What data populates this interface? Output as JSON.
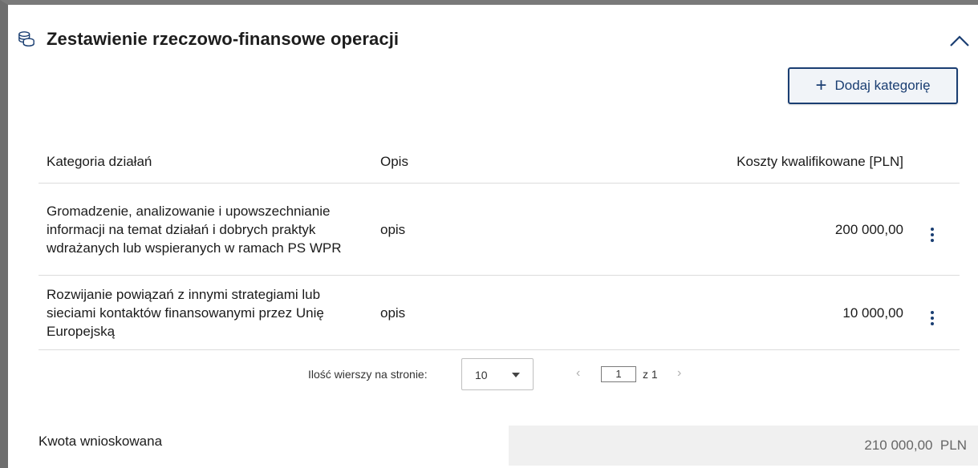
{
  "section": {
    "title": "Zestawienie rzeczowo-finansowe operacji",
    "icon": "database-stack-icon",
    "collapse_icon": "chevron-up-icon"
  },
  "add_button": {
    "label": "Dodaj kategorię",
    "icon": "plus-icon"
  },
  "table": {
    "columns": [
      "Kategoria działań",
      "Opis",
      "Koszty kwalifikowane [PLN]"
    ],
    "rows": [
      {
        "category": "Gromadzenie, analizowanie i upowszechnianie informacji na temat działań i dobrych praktyk wdrażanych lub wspieranych w ramach PS WPR",
        "description": "opis",
        "cost": "200 000,00"
      },
      {
        "category": "Rozwijanie powiązań z innymi strategiami lub sieciami kontaktów finansowanymi przez Unię Europejską",
        "description": "opis",
        "cost": "10 000,00"
      }
    ]
  },
  "pagination": {
    "rows_label": "Ilość wierszy na stronie:",
    "rows_value": "10",
    "current_page": "1",
    "total_label": "z 1"
  },
  "summary": {
    "label": "Kwota wnioskowana",
    "value": "210 000,00  PLN"
  },
  "colors": {
    "accent": "#1a3e72",
    "summary_bg": "#f0f0f0"
  }
}
